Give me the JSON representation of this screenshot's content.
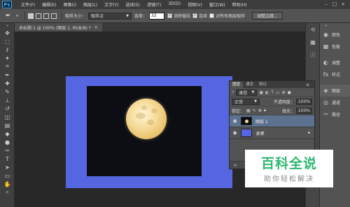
{
  "app": {
    "logo": "Ps"
  },
  "menu": [
    "文件(F)",
    "编辑(E)",
    "图像(I)",
    "图层(L)",
    "文字(Y)",
    "选择(S)",
    "滤镜(T)",
    "3D(D)",
    "视图(V)",
    "窗口(W)",
    "帮助(H)"
  ],
  "window_controls": {
    "minimize": "–",
    "maximize": "□",
    "close": "×"
  },
  "options": {
    "sample_size_label": "取样大小：",
    "sample_size_value": "取样点",
    "tolerance_label": "容差：",
    "tolerance_value": "32",
    "anti_alias_label": "消除锯齿",
    "contiguous_label": "连续",
    "sample_all_label": "对所有图层取样",
    "refine_edge_label": "调整边缘..."
  },
  "document": {
    "tab_label": "未标题-1 @ 100% (图层 1, RGB/8) *",
    "close": "×"
  },
  "dock": {
    "history_label": "历史记录",
    "color_label": "颜色",
    "swatches_label": "色板",
    "adjustments_label": "调整",
    "styles_label": "样式",
    "layers_label": "图层",
    "channels_label": "通道",
    "paths_label": "路径"
  },
  "layers_panel": {
    "tabs": [
      "图层",
      "通道",
      "路径"
    ],
    "filter_value": "类型",
    "blend_mode": "正常",
    "opacity_label": "不透明度：",
    "opacity_value": "100%",
    "lock_label": "锁定：",
    "fill_label": "填充：",
    "fill_value": "100%",
    "layers": [
      {
        "name": "图层 1"
      },
      {
        "name": "背景"
      }
    ]
  },
  "watermark": {
    "title": "百科全说",
    "subtitle": "助你轻松解决"
  },
  "colors": {
    "canvas_bg": "#5566e0",
    "selection": "#5d7290",
    "brand_green": "#2eb872"
  }
}
